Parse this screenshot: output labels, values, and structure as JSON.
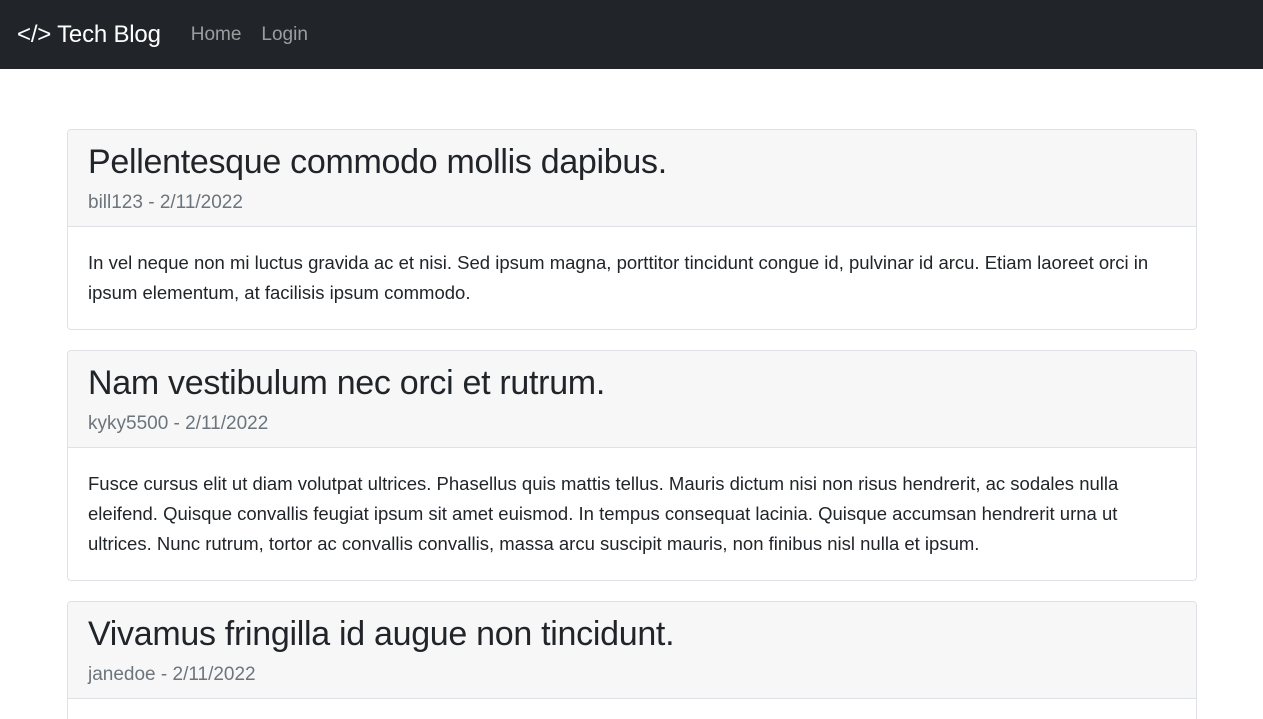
{
  "navbar": {
    "brand": "</> Tech Blog",
    "links": [
      {
        "label": "Home"
      },
      {
        "label": "Login"
      }
    ]
  },
  "posts": [
    {
      "title": "Pellentesque commodo mollis dapibus.",
      "meta": "bill123 - 2/11/2022",
      "body": "In vel neque non mi luctus gravida ac et nisi. Sed ipsum magna, porttitor tincidunt congue id, pulvinar id arcu. Etiam laoreet orci in ipsum elementum, at facilisis ipsum commodo."
    },
    {
      "title": "Nam vestibulum nec orci et rutrum.",
      "meta": "kyky5500 - 2/11/2022",
      "body": "Fusce cursus elit ut diam volutpat ultrices. Phasellus quis mattis tellus. Mauris dictum nisi non risus hendrerit, ac sodales nulla eleifend. Quisque convallis feugiat ipsum sit amet euismod. In tempus consequat lacinia. Quisque accumsan hendrerit urna ut ultrices. Nunc rutrum, tortor ac convallis convallis, massa arcu suscipit mauris, non finibus nisl nulla et ipsum."
    },
    {
      "title": "Vivamus fringilla id augue non tincidunt.",
      "meta": "janedoe - 2/11/2022",
      "body": ""
    }
  ],
  "colors": {
    "navbar_bg": "#212529",
    "card_header_bg": "#f7f7f7",
    "meta_text": "#6c757d"
  }
}
